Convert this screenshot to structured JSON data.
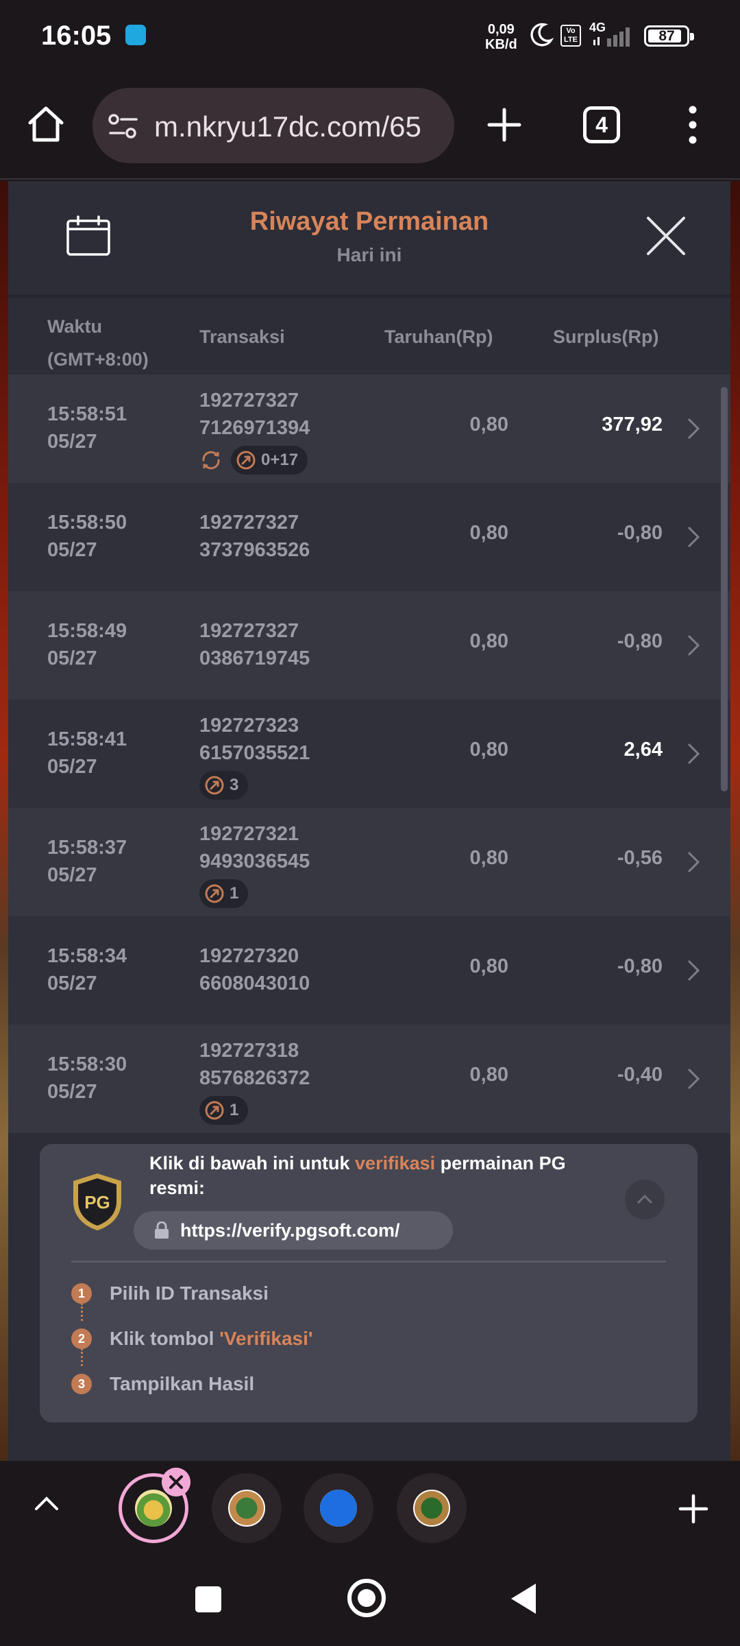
{
  "status_bar": {
    "time": "16:05",
    "net_speed_value": "0,09",
    "net_speed_unit": "KB/d",
    "volte_top": "Vo",
    "volte_bottom": "LTE",
    "network": "4G",
    "battery": "87"
  },
  "browser": {
    "url": "m.nkryu17dc.com/65",
    "tab_count": "4"
  },
  "panel": {
    "title": "Riwayat Permainan",
    "subtitle": "Hari ini",
    "columns": {
      "time_line1": "Waktu",
      "time_line2": "(GMT+8:00)",
      "transaction": "Transaksi",
      "bet": "Taruhan(Rp)",
      "surplus": "Surplus(Rp)"
    },
    "rows": [
      {
        "time": "15:58:51",
        "date": "05/27",
        "trx1": "192727327",
        "trx2": "7126971394",
        "bet": "0,80",
        "surplus": "377,92",
        "spin_badge": "0+17"
      },
      {
        "time": "15:58:50",
        "date": "05/27",
        "trx1": "192727327",
        "trx2": "3737963526",
        "bet": "0,80",
        "surplus": "-0,80"
      },
      {
        "time": "15:58:49",
        "date": "05/27",
        "trx1": "192727327",
        "trx2": "0386719745",
        "bet": "0,80",
        "surplus": "-0,80"
      },
      {
        "time": "15:58:41",
        "date": "05/27",
        "trx1": "192727323",
        "trx2": "6157035521",
        "bet": "0,80",
        "surplus": "2,64",
        "spin_badge": "3"
      },
      {
        "time": "15:58:37",
        "date": "05/27",
        "trx1": "192727321",
        "trx2": "9493036545",
        "bet": "0,80",
        "surplus": "-0,56",
        "spin_badge": "1"
      },
      {
        "time": "15:58:34",
        "date": "05/27",
        "trx1": "192727320",
        "trx2": "6608043010",
        "bet": "0,80",
        "surplus": "-0,80"
      },
      {
        "time": "15:58:30",
        "date": "05/27",
        "trx1": "192727318",
        "trx2": "8576826372",
        "bet": "0,80",
        "surplus": "-0,40",
        "spin_badge": "1"
      }
    ]
  },
  "verify": {
    "text_pre": "Klik di bawah ini untuk ",
    "text_highlight": "verifikasi",
    "text_post": " permainan PG resmi:",
    "logo_text": "PG",
    "link": "https://verify.pgsoft.com/",
    "steps": [
      {
        "num": "1",
        "label": "Pilih ID Transaksi"
      },
      {
        "num": "2",
        "label_pre": "Klik tombol ",
        "label_highlight": "'Verifikasi'"
      },
      {
        "num": "3",
        "label": "Tampilkan Hasil"
      }
    ]
  },
  "colors": {
    "accent": "#d8845a",
    "panel_bg": "#2c2d37",
    "win_text": "#ffffff",
    "tab_active_ring": "#f2a8d6"
  }
}
